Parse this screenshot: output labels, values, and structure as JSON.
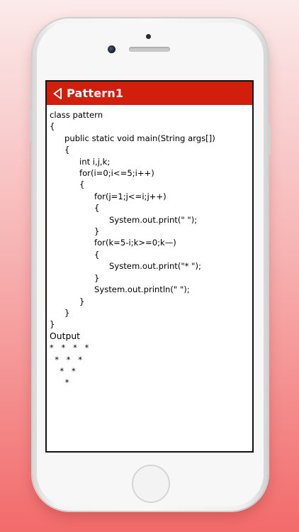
{
  "app_bar": {
    "title": "Pattern1",
    "background": "#d21f0d",
    "back_icon": "chevron-left-outline-icon"
  },
  "program": {
    "lines": [
      {
        "indent": 0,
        "text": "class pattern"
      },
      {
        "indent": 0,
        "text": "{"
      },
      {
        "indent": 1,
        "text": "public static void main(String args[])"
      },
      {
        "indent": 1,
        "text": "{"
      },
      {
        "indent": 2,
        "text": "int i,j,k;"
      },
      {
        "indent": 2,
        "text": "for(i=0;i<=5;i++)"
      },
      {
        "indent": 2,
        "text": "{"
      },
      {
        "indent": 3,
        "text": "for(j=1;j<=i;j++)"
      },
      {
        "indent": 3,
        "text": "{"
      },
      {
        "indent": 4,
        "text": "System.out.print(\" \");"
      },
      {
        "indent": 3,
        "text": "}"
      },
      {
        "indent": 3,
        "text": "for(k=5-i;k>=0;k—)"
      },
      {
        "indent": 3,
        "text": "{"
      },
      {
        "indent": 4,
        "text": "System.out.print(\"* \");"
      },
      {
        "indent": 3,
        "text": "}"
      },
      {
        "indent": 3,
        "text": "System.out.println(\" \");"
      },
      {
        "indent": 2,
        "text": "}"
      },
      {
        "indent": 1,
        "text": "}"
      },
      {
        "indent": 0,
        "text": "}"
      }
    ]
  },
  "output": {
    "label": "Output",
    "lines": [
      "*   *   *   *",
      "  *   *   *",
      "    *   *",
      "      *"
    ]
  }
}
